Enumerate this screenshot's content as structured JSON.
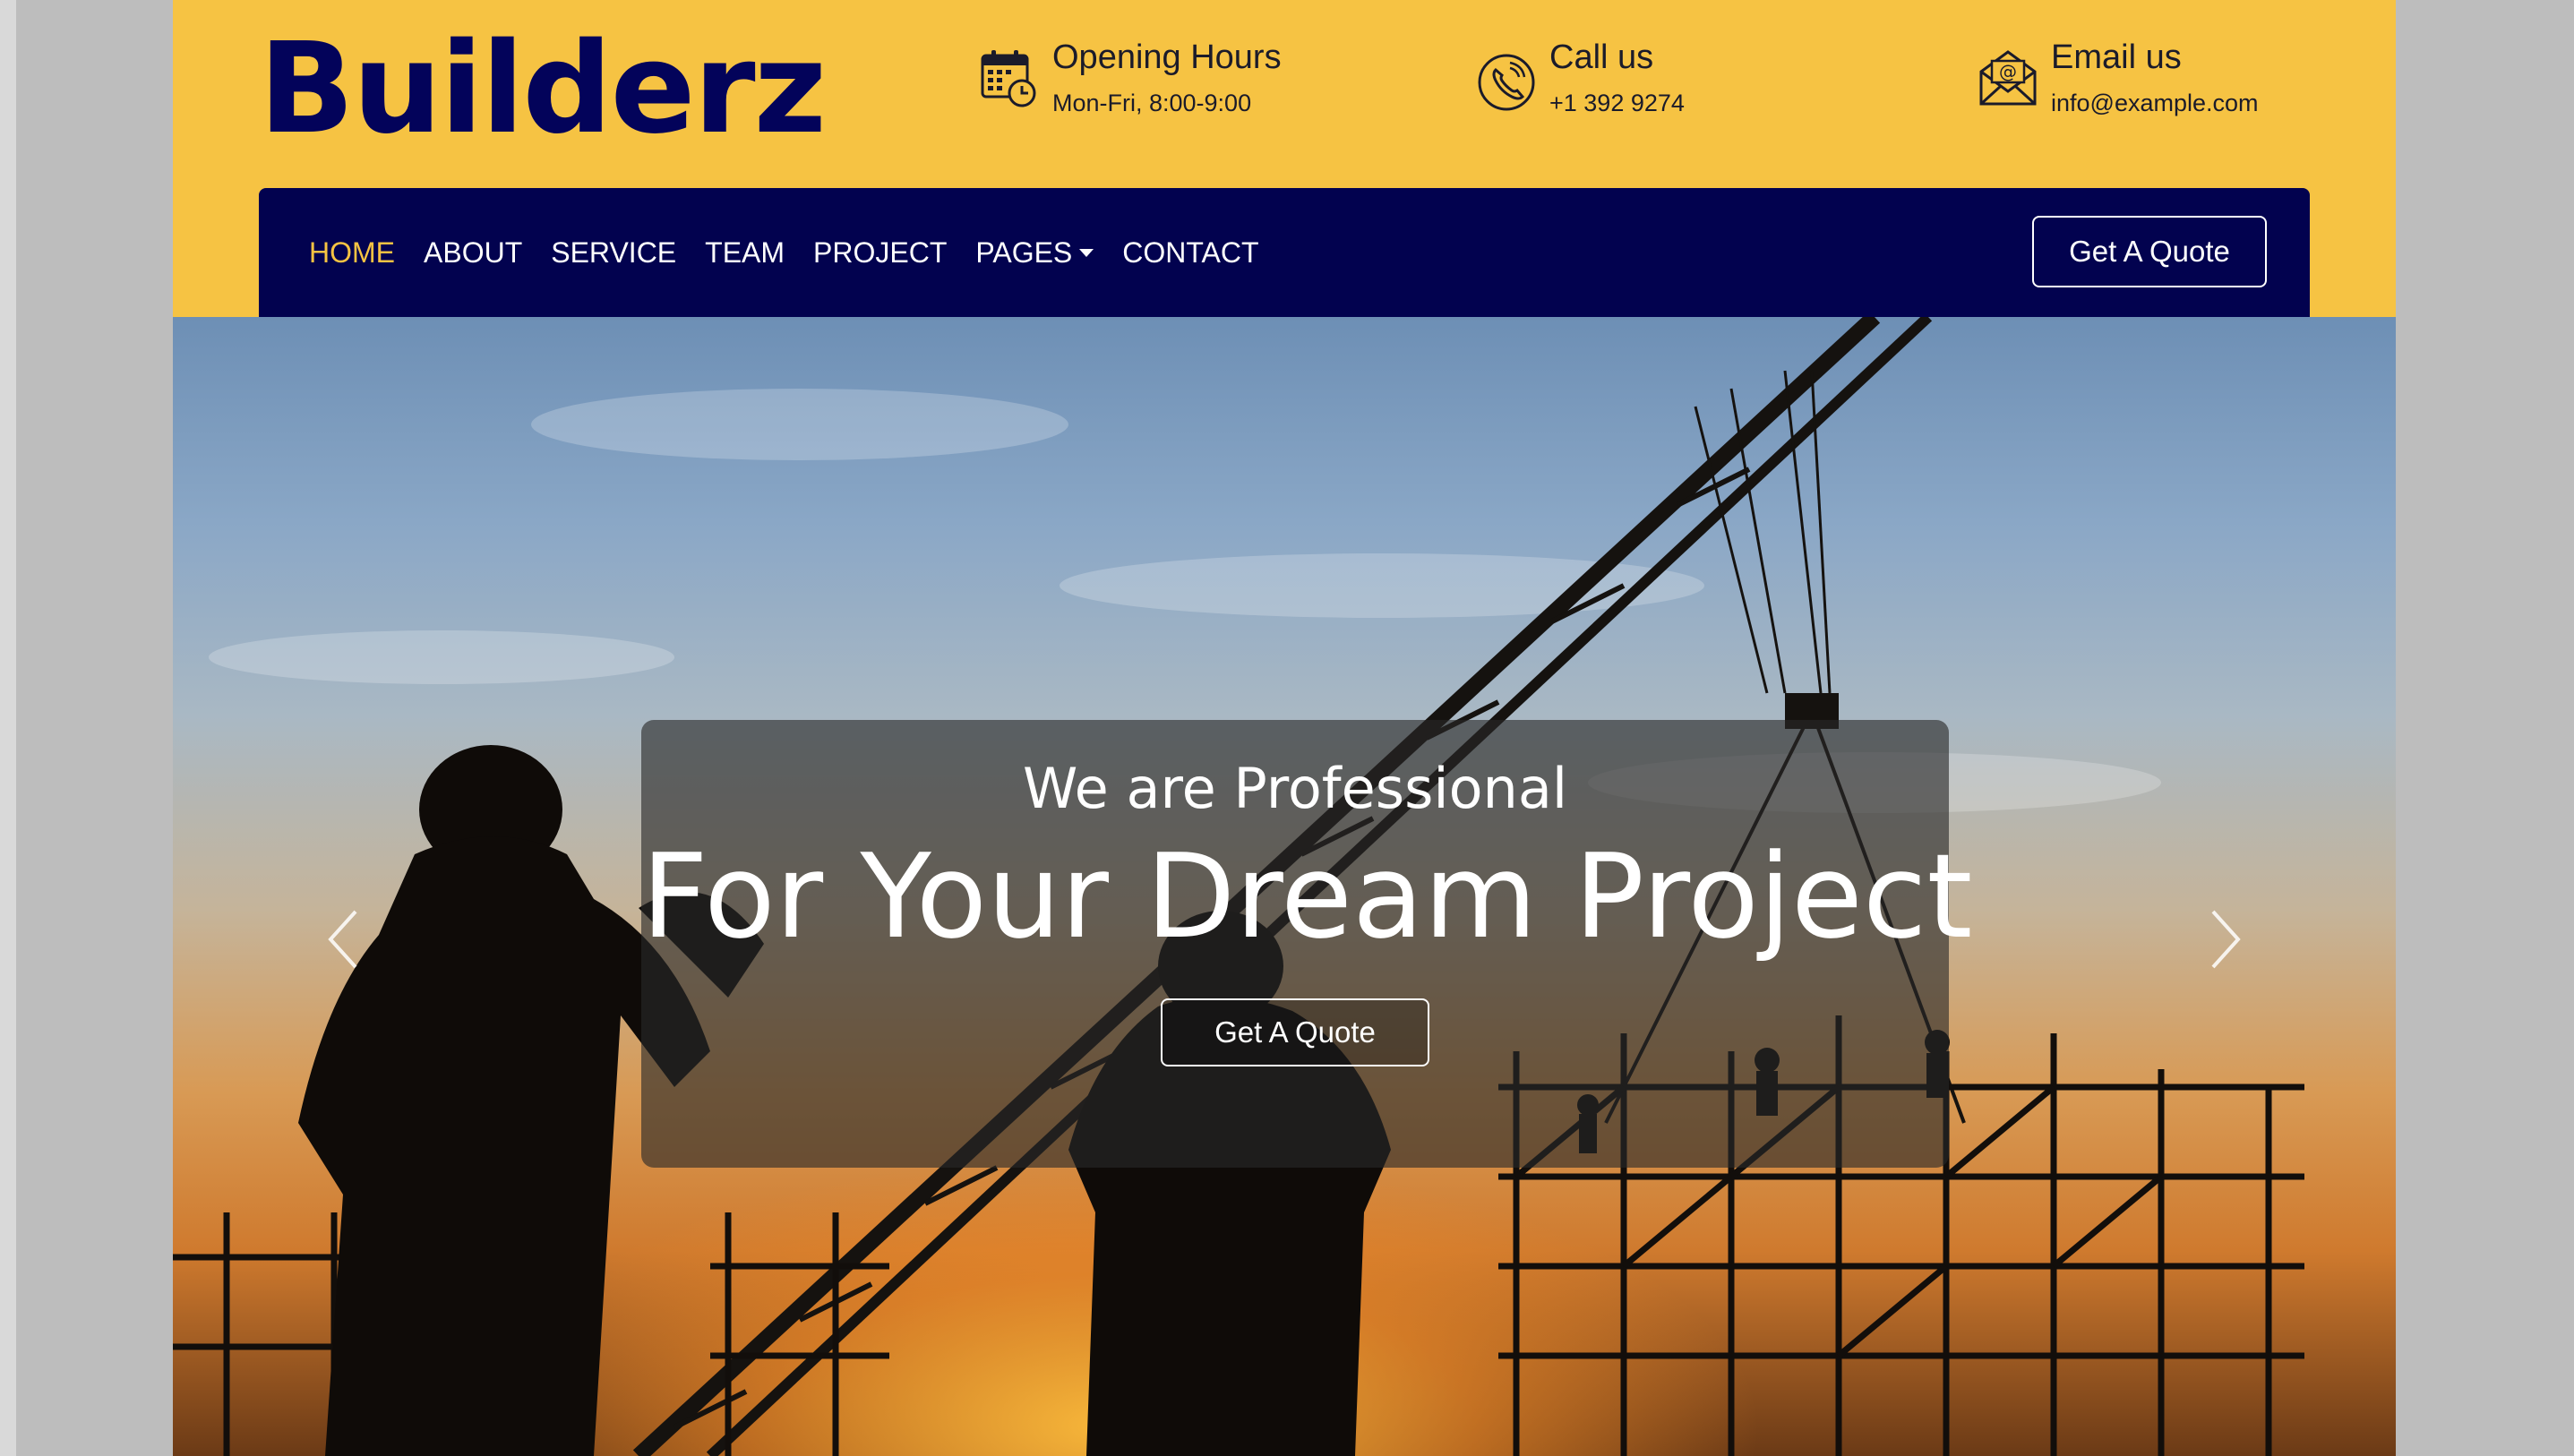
{
  "brand": {
    "logo": "Builderz"
  },
  "header": {
    "hours": {
      "title": "Opening Hours",
      "value": "Mon-Fri, 8:00-9:00",
      "icon": "calendar-clock-icon"
    },
    "call": {
      "title": "Call us",
      "value": "+1 392 9274",
      "icon": "phone-icon"
    },
    "email": {
      "title": "Email us",
      "value": "info@example.com",
      "icon": "envelope-icon"
    }
  },
  "nav": {
    "items": [
      {
        "label": "HOME",
        "active": true
      },
      {
        "label": "ABOUT"
      },
      {
        "label": "SERVICE"
      },
      {
        "label": "TEAM"
      },
      {
        "label": "PROJECT"
      },
      {
        "label": "PAGES",
        "dropdown": true
      },
      {
        "label": "CONTACT"
      }
    ],
    "quote_label": "Get A Quote"
  },
  "hero": {
    "subtitle": "We are Professional",
    "title": "For Your Dream Project",
    "button_label": "Get A Quote",
    "prev_icon": "chevron-left-icon",
    "next_icon": "chevron-right-icon"
  },
  "colors": {
    "accent": "#f6c343",
    "navy": "#02024f",
    "logo": "#03035a"
  }
}
